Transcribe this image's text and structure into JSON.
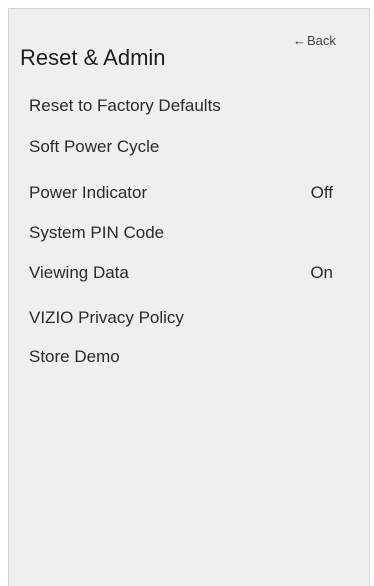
{
  "header": {
    "back_label": "Back",
    "title": "Reset & Admin"
  },
  "menu": {
    "items": [
      {
        "label": "Reset to Factory Defaults",
        "value": ""
      },
      {
        "label": "Soft Power Cycle",
        "value": ""
      },
      {
        "label": "Power Indicator",
        "value": "Off"
      },
      {
        "label": "System PIN Code",
        "value": ""
      },
      {
        "label": "Viewing Data",
        "value": "On"
      },
      {
        "label": "VIZIO Privacy Policy",
        "value": ""
      },
      {
        "label": "Store Demo",
        "value": ""
      }
    ]
  }
}
